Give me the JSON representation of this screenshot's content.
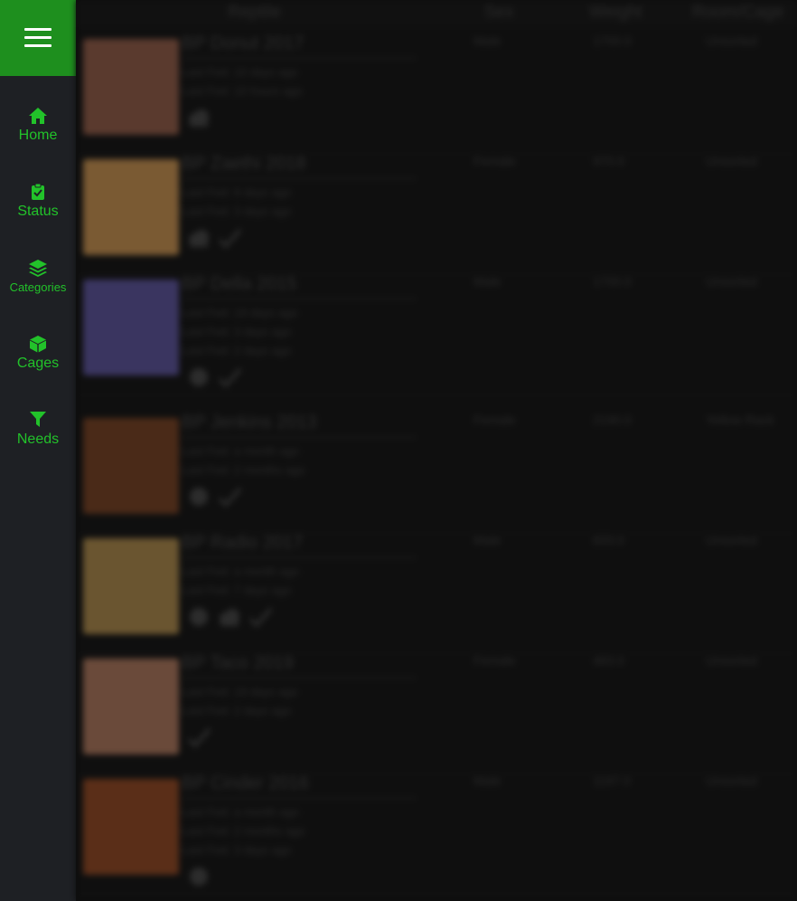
{
  "sidebar": {
    "menu_icon": "hamburger-icon",
    "accent_color": "#22c22a",
    "menu_bg_color": "#1e8f1e",
    "items": [
      {
        "label": "Home",
        "icon": "home-icon"
      },
      {
        "label": "Status",
        "icon": "clipboard-check-icon"
      },
      {
        "label": "Categories",
        "icon": "layers-icon"
      },
      {
        "label": "Cages",
        "icon": "cube-icon"
      },
      {
        "label": "Needs",
        "icon": "filter-icon"
      }
    ]
  },
  "table": {
    "headers": [
      "Reptile",
      "Sex",
      "Weight",
      "Room/Cage"
    ],
    "rows": [
      {
        "name": "BP Donut 2017",
        "fed": [
          "Last Fed: 10 days ago",
          "Last Fed: 10 hours ago"
        ],
        "sex": "Male",
        "weight": "1700.0",
        "cage": "Unsorted",
        "thumb": "#5a3a2e",
        "icons": [
          "cloud"
        ]
      },
      {
        "name": "BP Zaethi 2018",
        "fed": [
          "Last Fed: 9 days ago",
          "Last Fed: 3 days ago"
        ],
        "sex": "Female",
        "weight": "970.0",
        "cage": "Unsorted",
        "thumb": "#7a5a33",
        "icons": [
          "cloud",
          "check"
        ]
      },
      {
        "name": "BP Della 2015",
        "fed": [
          "Last Fed: 19 days ago",
          "Last Fed: 3 days ago",
          "Last Fed: 2 days ago"
        ],
        "sex": "Male",
        "weight": "1700.0",
        "cage": "Unsorted",
        "thumb": "#3a3560",
        "icons": [
          "ball",
          "check"
        ]
      },
      {
        "name": "BP Jenkins 2013",
        "fed": [
          "Last Fed: a month ago",
          "Last Fed: 2 months ago"
        ],
        "sex": "Female",
        "weight": "2190.0",
        "cage": "Yellow Rack",
        "thumb": "#4a2a18",
        "icons": [
          "ball",
          "check"
        ]
      },
      {
        "name": "BP Radio 2017",
        "fed": [
          "Last Fed: a month ago",
          "Last Fed: 7 days ago"
        ],
        "sex": "Male",
        "weight": "833.0",
        "cage": "Unsorted",
        "thumb": "#6a5530",
        "icons": [
          "ball",
          "cloud",
          "check"
        ]
      },
      {
        "name": "BP Taco 2019",
        "fed": [
          "Last Fed: 19 days ago",
          "Last Fed: 2 days ago"
        ],
        "sex": "Female",
        "weight": "483.0",
        "cage": "Unsorted",
        "thumb": "#6a4a3a",
        "icons": [
          "check"
        ]
      },
      {
        "name": "BP Cinder 2016",
        "fed": [
          "Last Fed: a month ago",
          "Last Fed: 2 months ago",
          "Last Fed: 3 days ago"
        ],
        "sex": "Male",
        "weight": "1197.0",
        "cage": "Unsorted",
        "thumb": "#5a2e18",
        "icons": [
          "ball"
        ]
      }
    ]
  }
}
